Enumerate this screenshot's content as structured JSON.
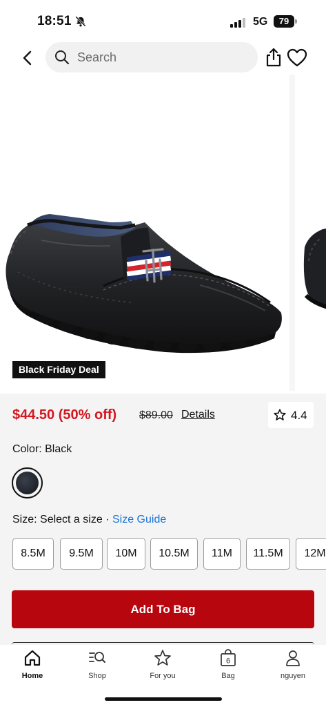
{
  "status_bar": {
    "time": "18:51",
    "network": "5G",
    "battery": "79"
  },
  "header": {
    "search_placeholder": "Search"
  },
  "gallery": {
    "badge": "Black Friday Deal"
  },
  "price": {
    "sale": "$44.50 (50% off)",
    "original": "$89.00",
    "details_link": "Details",
    "rating": "4.4"
  },
  "options": {
    "color_label": "Color: Black",
    "swatch_color": "#1a1d24",
    "size_label": "Size: Select a size",
    "separator": "·",
    "size_guide": "Size Guide",
    "sizes": [
      "8.5M",
      "9.5M",
      "10M",
      "10.5M",
      "11M",
      "11.5M",
      "12M"
    ]
  },
  "cta": {
    "add_to_bag": "Add To Bag",
    "color": "#b8060e"
  },
  "tabbar": {
    "items": [
      {
        "label": "Home",
        "icon": "home-icon",
        "active": true
      },
      {
        "label": "Shop",
        "icon": "shop-search-icon"
      },
      {
        "label": "For you",
        "icon": "star-icon"
      },
      {
        "label": "Bag",
        "icon": "bag-icon",
        "badge": "6"
      },
      {
        "label": "nguyen",
        "icon": "user-icon"
      }
    ]
  },
  "colors": {
    "sale_red": "#d4161f",
    "link_blue": "#1a73d9",
    "accent": "#b8060e"
  }
}
